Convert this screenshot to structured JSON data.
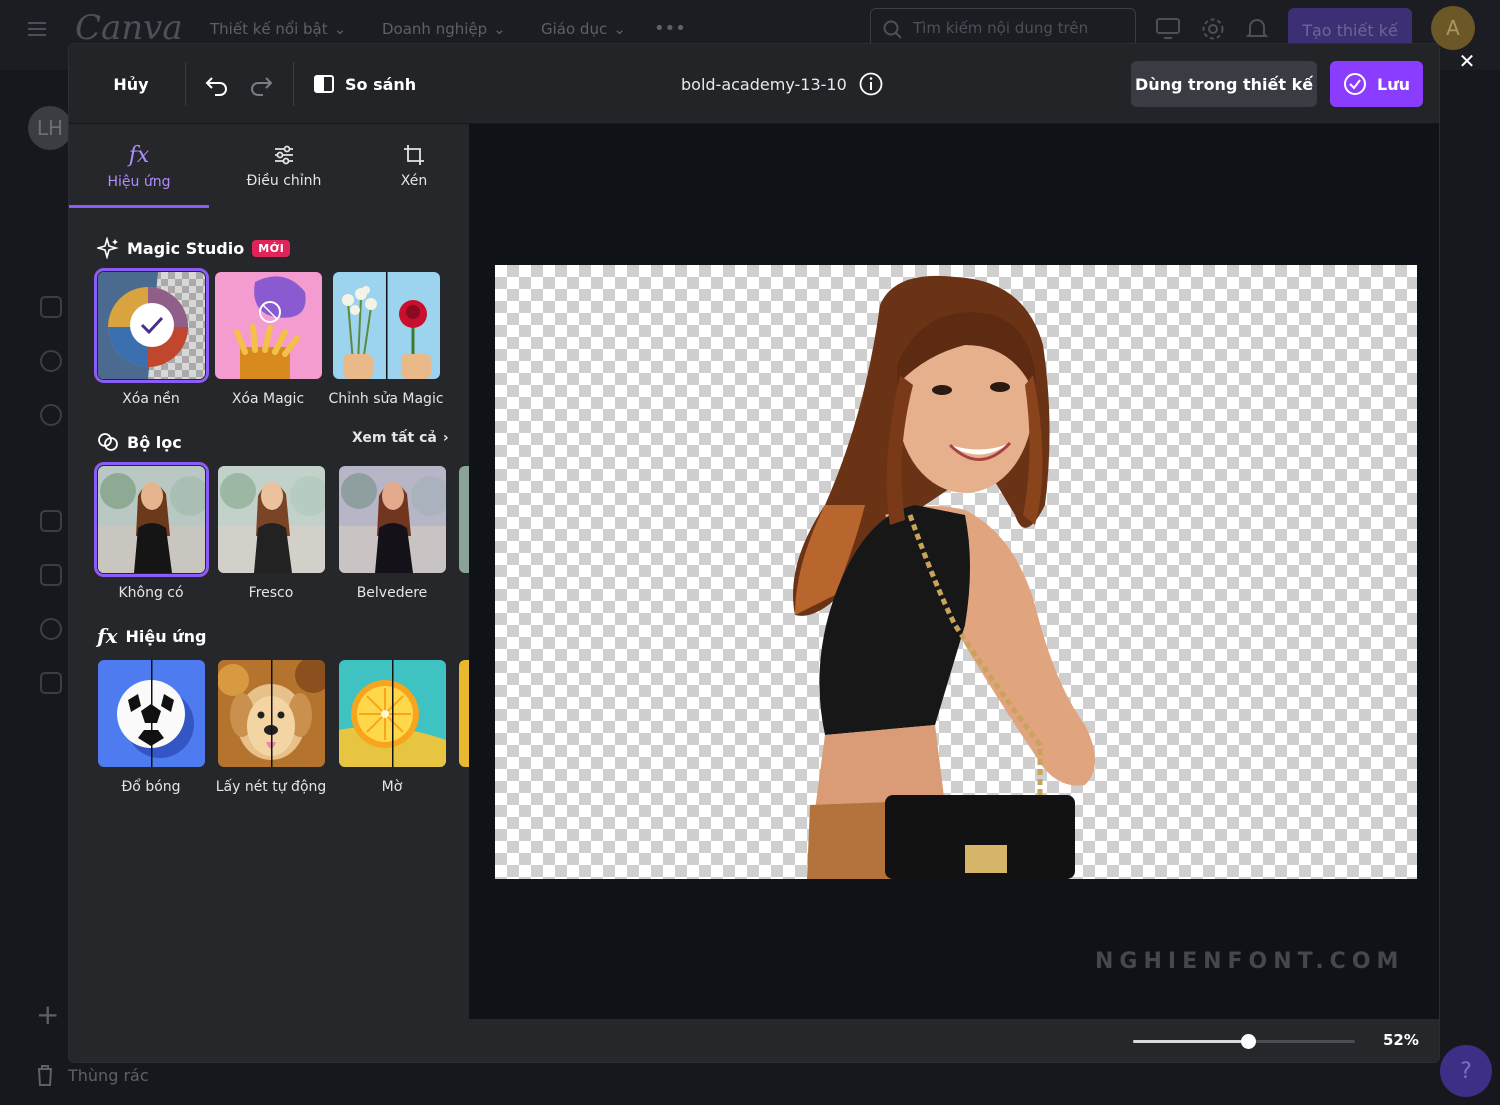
{
  "app": {
    "logo": "Canva",
    "nav": [
      "Thiết kế nổi bật",
      "Doanh nghiệp",
      "Giáo dục"
    ],
    "more": "•••",
    "search_placeholder": "Tìm kiếm nội dung trên",
    "create_button": "Tạo thiết kế",
    "avatar": "A",
    "user_initials": "LH",
    "trash_label": "Thùng rác",
    "help": "?"
  },
  "editor": {
    "cancel": "Hủy",
    "compare": "So sánh",
    "filename": "bold-academy-13-10",
    "use_in_design": "Dùng trong thiết kế",
    "save": "Lưu",
    "tabs": [
      {
        "label": "Hiệu ứng",
        "icon": "fx-icon",
        "active": true
      },
      {
        "label": "Điều chỉnh",
        "icon": "sliders-icon",
        "active": false
      },
      {
        "label": "Xén",
        "icon": "crop-icon",
        "active": false
      }
    ],
    "magic_studio": {
      "title": "Magic Studio",
      "badge": "MỚI",
      "items": [
        {
          "label": "Xóa nền",
          "selected": true
        },
        {
          "label": "Xóa Magic",
          "selected": false
        },
        {
          "label": "Chỉnh sửa Magic",
          "selected": false
        }
      ]
    },
    "filters": {
      "title": "Bộ lọc",
      "see_all": "Xem tất cả",
      "items": [
        {
          "label": "Không có",
          "selected": true
        },
        {
          "label": "Fresco",
          "selected": false
        },
        {
          "label": "Belvedere",
          "selected": false
        }
      ]
    },
    "effects": {
      "title": "Hiệu ứng",
      "items": [
        {
          "label": "Đổ bóng"
        },
        {
          "label": "Lấy nét tự động"
        },
        {
          "label": "Mờ"
        }
      ]
    },
    "zoom": {
      "value": 0.52,
      "label": "52%"
    },
    "watermark": "NGHIENFONT.COM"
  },
  "colors": {
    "accent": "#8b3dff",
    "active_tab": "#b28bff",
    "badge": "#e0245a"
  }
}
